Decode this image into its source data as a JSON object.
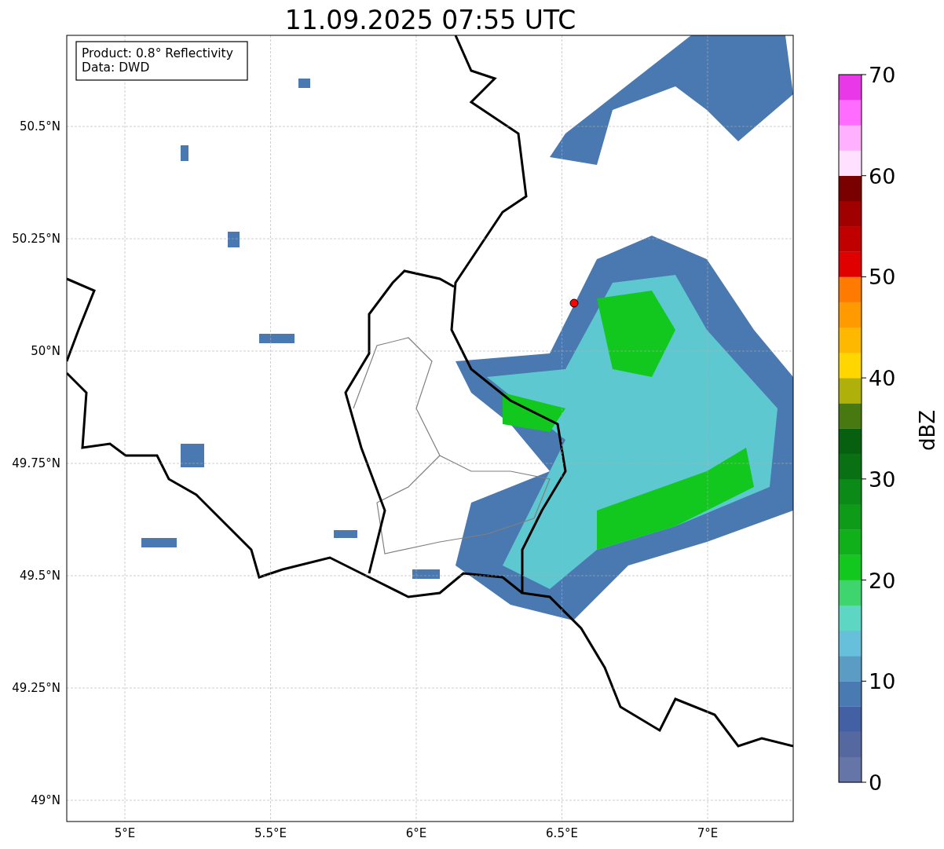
{
  "title": "11.09.2025 07:55 UTC",
  "info_box": [
    "Product: 0.8° Reflectivity",
    "Data: DWD"
  ],
  "map": {
    "x_ticks": [
      "5°E",
      "5.5°E",
      "6°E",
      "6.5°E",
      "7°E"
    ],
    "y_ticks": [
      "50.5°N",
      "50.25°N",
      "50°N",
      "49.75°N",
      "49.5°N",
      "49.25°N",
      "49°N"
    ]
  },
  "colorbar": {
    "label": "dBZ",
    "ticks": [
      "70",
      "60",
      "50",
      "40",
      "30",
      "20",
      "10",
      "0"
    ],
    "bins": [
      {
        "color": "#6675a8"
      },
      {
        "color": "#5668a0"
      },
      {
        "color": "#4460a5"
      },
      {
        "color": "#4a7ab2"
      },
      {
        "color": "#5a9cc4"
      },
      {
        "color": "#66c0dc"
      },
      {
        "color": "#5ed6c4"
      },
      {
        "color": "#3ed46e"
      },
      {
        "color": "#12c81e"
      },
      {
        "color": "#10b01a"
      },
      {
        "color": "#0e9c18"
      },
      {
        "color": "#0c8a18"
      },
      {
        "color": "#0a7014"
      },
      {
        "color": "#066010"
      },
      {
        "color": "#487810"
      },
      {
        "color": "#b0b00a"
      },
      {
        "color": "#ffd600"
      },
      {
        "color": "#ffb800"
      },
      {
        "color": "#ff9a00"
      },
      {
        "color": "#ff7a00"
      },
      {
        "color": "#e00000"
      },
      {
        "color": "#c00000"
      },
      {
        "color": "#a00000"
      },
      {
        "color": "#7a0000"
      },
      {
        "color": "#ffe0ff"
      },
      {
        "color": "#ffb0ff"
      },
      {
        "color": "#ff6cff"
      },
      {
        "color": "#e838e8"
      }
    ]
  }
}
